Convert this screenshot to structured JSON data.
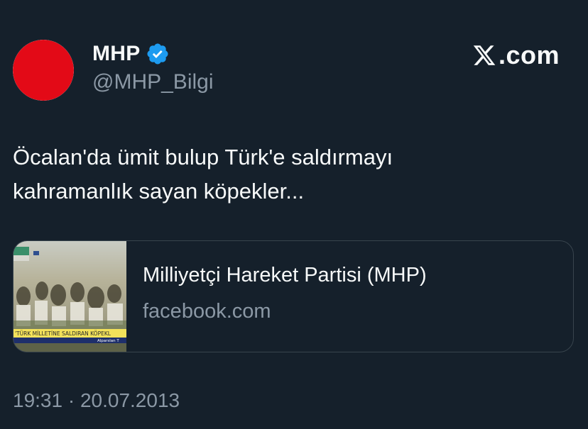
{
  "tweet": {
    "author": {
      "display_name": "MHP",
      "handle": "@MHP_Bilgi",
      "verified": true,
      "avatar_icon": "mhp-crescents-logo"
    },
    "brand": {
      "logo_icon": "x-logo-icon",
      "text": ".com"
    },
    "text": "Öcalan'da ümit bulup Türk'e saldırmayı\nkahramanlık sayan köpekler...",
    "link_card": {
      "title": "Milliyetçi Hareket Partisi (MHP)",
      "domain": "facebook.com",
      "thumbnail_caption": "'TÜRK MİLLETİNE SALDIRAN KÖPEKL",
      "thumbnail_subcaption": "Alparslan T"
    },
    "timestamp": "19:31 · 20.07.2013"
  },
  "colors": {
    "background": "#15202b",
    "primary_text": "#f7f9f9",
    "secondary_text": "#8b98a5",
    "border": "#38444d",
    "verified_blue": "#1d9bf0",
    "logo_red": "#e30a17"
  }
}
